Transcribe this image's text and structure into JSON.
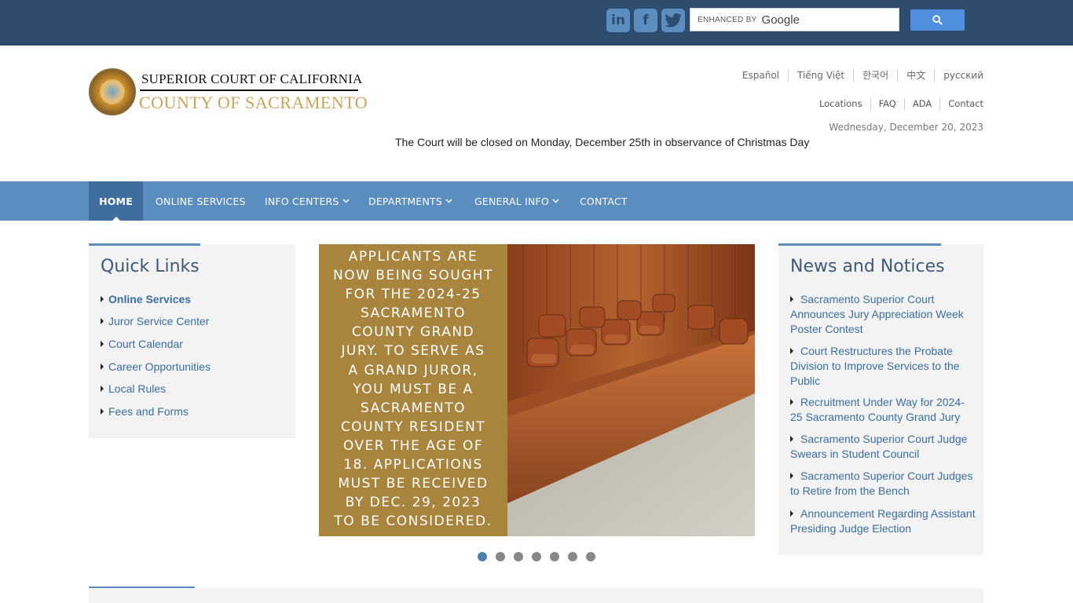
{
  "topbar": {
    "social": [
      {
        "name": "linkedin-icon",
        "glyph": "in"
      },
      {
        "name": "facebook-icon",
        "glyph": "f"
      },
      {
        "name": "twitter-icon",
        "glyph": "t"
      }
    ],
    "search": {
      "enhanced_label": "ENHANCED BY",
      "brand": "Google",
      "button_icon": "search-icon"
    }
  },
  "header": {
    "title_line1": "SUPERIOR COURT OF CALIFORNIA",
    "title_line2": "COUNTY OF SACRAMENTO",
    "languages": [
      "Español",
      "Tiếng Việt",
      "한국어",
      "中文",
      "русский"
    ],
    "utility_links": [
      "Locations",
      "FAQ",
      "ADA",
      "Contact"
    ],
    "date": "Wednesday, December 20, 2023",
    "notice": "The Court will be closed on Monday, December 25th in observance of Christmas Day"
  },
  "nav": {
    "items": [
      {
        "label": "HOME",
        "active": true
      },
      {
        "label": "ONLINE SERVICES"
      },
      {
        "label": "INFO CENTERS",
        "dropdown": true
      },
      {
        "label": "DEPARTMENTS",
        "dropdown": true
      },
      {
        "label": "GENERAL INFO",
        "dropdown": true
      },
      {
        "label": "CONTACT"
      }
    ]
  },
  "quick_links": {
    "title": "Quick Links",
    "items": [
      "Online Services",
      "Juror Service Center",
      "Court Calendar",
      "Career Opportunities",
      "Local Rules",
      "Fees and Forms"
    ]
  },
  "slide": {
    "text": "Applicants are now being sought for the 2024-25 Sacramento County Grand Jury. To serve as a Grand juror, you must be a Sacramento County resident over the age of 18. Applications must be received by Dec. 29, 2023 to be considered.",
    "lines": [
      "Applicants are",
      "now being sought",
      "for the 2024-25",
      "Sacramento",
      "County Grand",
      "Jury. To serve as",
      "a Grand juror,",
      "you must be a",
      "Sacramento",
      "County resident",
      "over the age of",
      "18. Applications",
      "must be received",
      "by Dec. 29, 2023",
      "to be considered."
    ],
    "dots_total": 7,
    "active_dot": 1
  },
  "news": {
    "title": "News and Notices",
    "items": [
      "Sacramento Superior Court Announces Jury Appreciation Week Poster Contest",
      "Court Restructures the Probate Division to Improve Services to the Public",
      "Recruitment Under Way for 2024-25 Sacramento County Grand Jury",
      "Sacramento Superior Court Judge Swears in Student Council",
      "Sacramento Superior Court Judges to Retire from the Bench",
      "Announcement Regarding Assistant Presiding Judge Election"
    ]
  },
  "colors": {
    "topbar": "#2e4c6d",
    "nav": "#5b8dbf",
    "nav_active": "#3f6e9e",
    "link": "#3a6e9e",
    "gold": "#c9a55a"
  }
}
